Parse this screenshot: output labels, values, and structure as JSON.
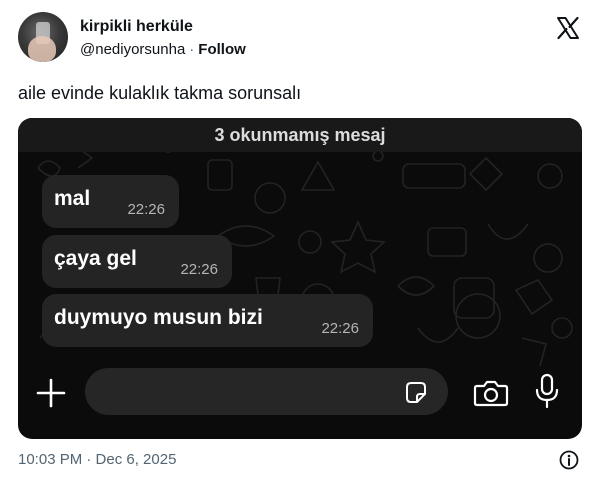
{
  "author": {
    "display_name": "kirpikli herküle",
    "handle": "@nediyorsunha",
    "separator": "·",
    "follow_label": "Follow"
  },
  "tweet": {
    "text": "aile evinde kulaklık takma sorunsalı",
    "timestamp": "10:03 PM · Dec 6, 2025"
  },
  "screenshot": {
    "unread_banner": "3 okunmamış mesaj",
    "messages": [
      {
        "text": "mal",
        "time": "22:26"
      },
      {
        "text": "çaya gel",
        "time": "22:26"
      },
      {
        "text": "duymuyo musun bizi",
        "time": "22:26"
      }
    ]
  },
  "icons": {
    "brand": "x-logo-icon",
    "info": "info-icon",
    "attach": "plus-icon",
    "sticker": "sticker-icon",
    "camera": "camera-icon",
    "mic": "microphone-icon"
  },
  "colors": {
    "text_primary": "#0f1419",
    "text_secondary": "#536471",
    "chat_background": "#0b0b0b",
    "bubble": "#242424"
  }
}
